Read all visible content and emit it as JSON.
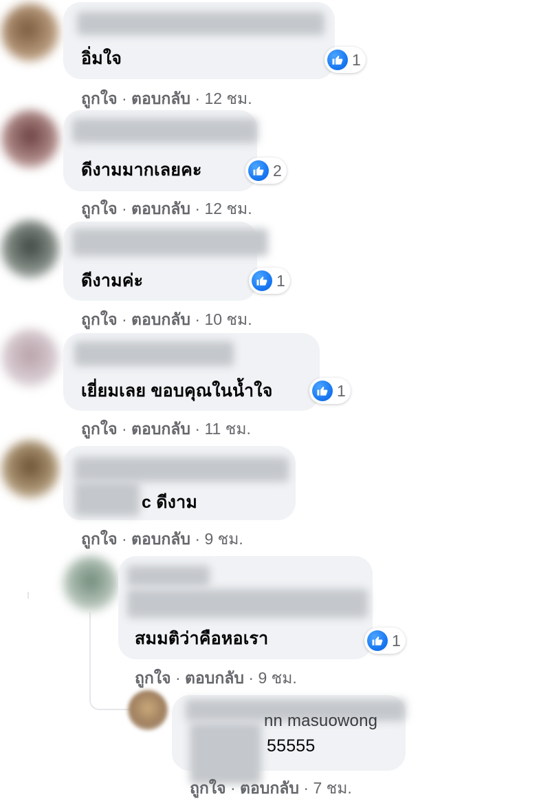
{
  "comments": [
    {
      "text": "อิ่มใจ",
      "reactions": "1",
      "like": "ถูกใจ",
      "reply": "ตอบกลับ",
      "time": "12 ชม."
    },
    {
      "text": "ดีงามมากเลยคะ",
      "reactions": "2",
      "like": "ถูกใจ",
      "reply": "ตอบกลับ",
      "time": "12 ชม."
    },
    {
      "text": "ดีงามค่ะ",
      "reactions": "1",
      "like": "ถูกใจ",
      "reply": "ตอบกลับ",
      "time": "10 ชม."
    },
    {
      "text": "เยี่ยมเลย ขอบคุณในน้ำใจ",
      "reactions": "1",
      "like": "ถูกใจ",
      "reply": "ตอบกลับ",
      "time": "11 ชม."
    },
    {
      "text": "c ดีงาม",
      "like": "ถูกใจ",
      "reply": "ตอบกลับ",
      "time": "9 ชม."
    },
    {
      "text": "สมมติว่าคือหอเรา",
      "reactions": "1",
      "like": "ถูกใจ",
      "reply": "ตอบกลับ",
      "time": "9 ชม."
    }
  ],
  "reply": {
    "name_fragment": "nn masuowong",
    "text": "55555",
    "like": "ถูกใจ",
    "reply": "ตอบกลับ",
    "time": "7 ชม."
  },
  "separator": "·",
  "colors": {
    "bubble": "#f0f2f5",
    "like_blue": "#1877f2",
    "meta": "#65676b",
    "text": "#050505"
  },
  "icons": {
    "reaction": "like-thumb-icon"
  }
}
